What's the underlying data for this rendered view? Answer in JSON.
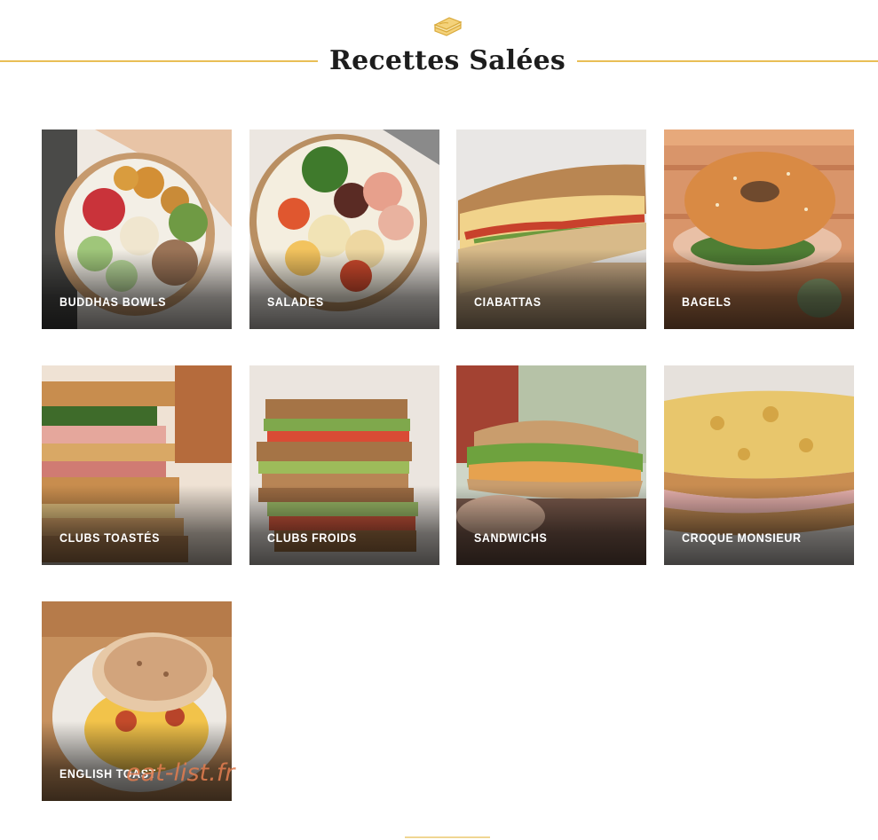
{
  "header": {
    "icon": "sandwich-icon",
    "title": "Recettes Salées",
    "accent_color": "#e9bf56"
  },
  "categories": [
    {
      "label": "BUDDHAS BOWLS"
    },
    {
      "label": "SALADES"
    },
    {
      "label": "CIABATTAS"
    },
    {
      "label": "BAGELS"
    },
    {
      "label": "CLUBS TOASTÉS"
    },
    {
      "label": "CLUBS FROIDS"
    },
    {
      "label": "SANDWICHS"
    },
    {
      "label": "CROQUE MONSIEUR"
    },
    {
      "label": "ENGLISH TOAST"
    }
  ],
  "watermark": "eat-list.fr"
}
